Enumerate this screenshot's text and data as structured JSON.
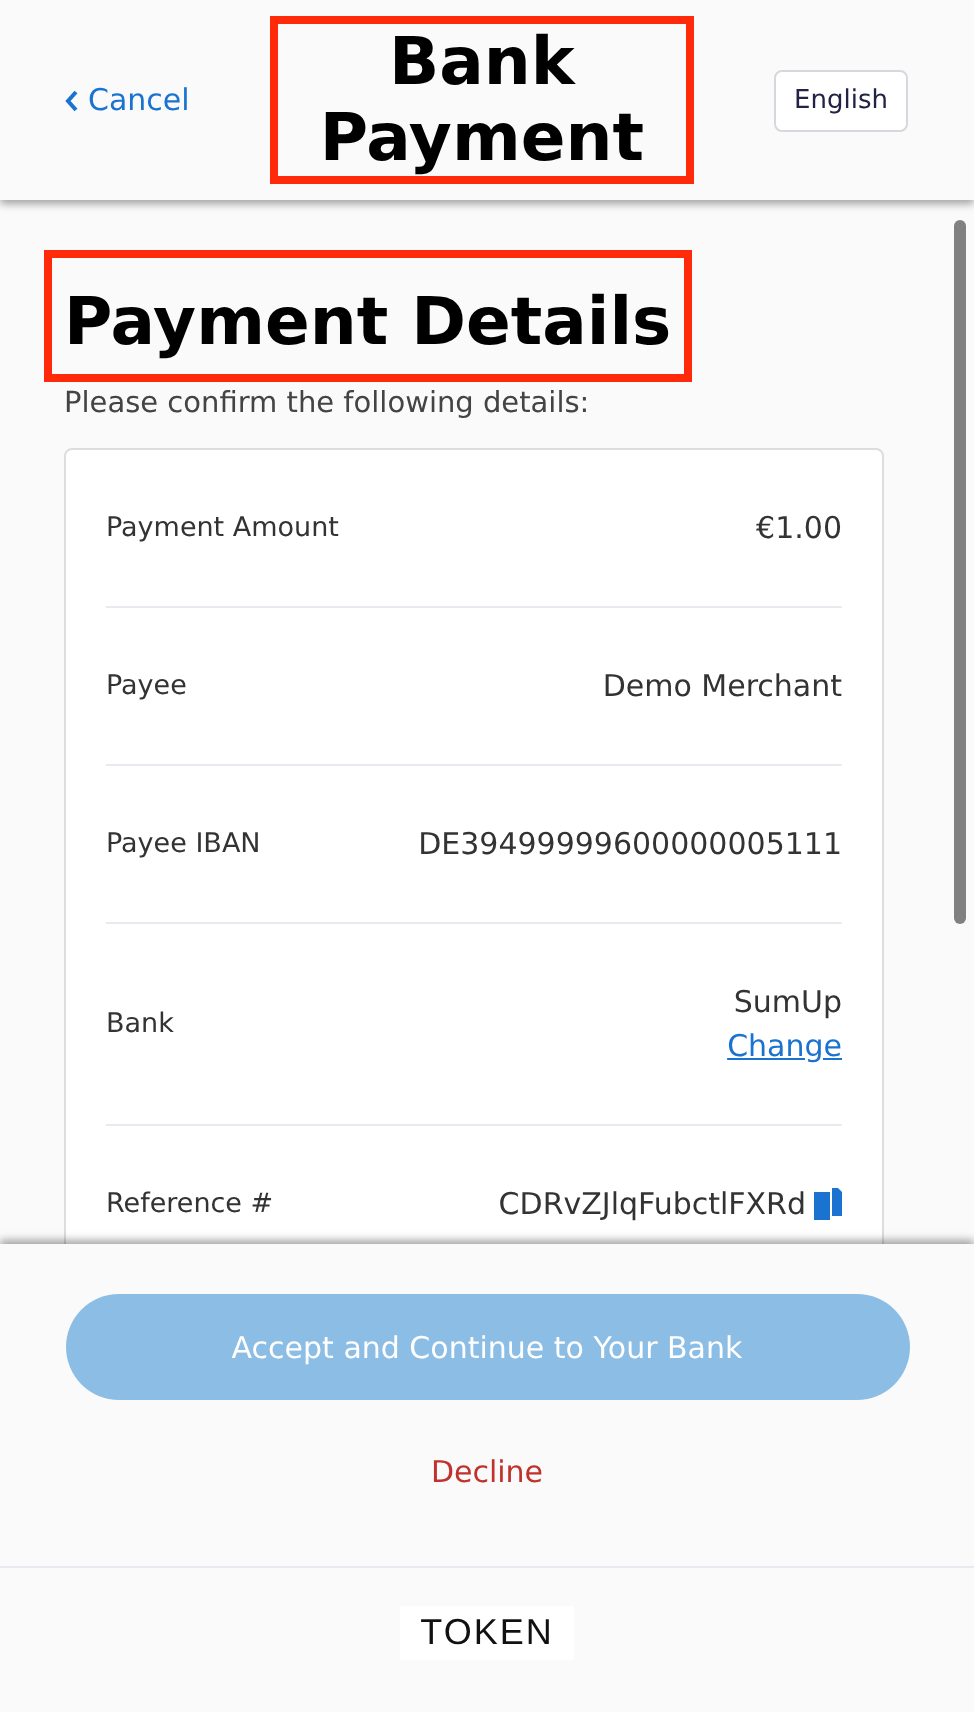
{
  "header": {
    "back_link": "Cancel",
    "title": "Bank Payment",
    "language_button": "English"
  },
  "content": {
    "heading": "Payment Details",
    "intro": "Please confirm the following details:",
    "rows": [
      {
        "kind": "text",
        "label": "Payment Amount",
        "value": "€1.00"
      },
      {
        "kind": "text",
        "label": "Payee",
        "value": "Demo Merchant"
      },
      {
        "kind": "text",
        "label": "Payee IBAN",
        "value": "DE39499999600000005111"
      },
      {
        "kind": "link",
        "label": "Bank",
        "value": "SumUp",
        "link": "Change"
      },
      {
        "kind": "copy",
        "label": "Reference #",
        "value": "CDRvZJlqFubctlFXRd"
      }
    ]
  },
  "footer": {
    "accept_button": {
      "label": "Accept and Continue to Your Bank",
      "disabled": true
    },
    "decline_link": "Decline",
    "brand": "TOKEN"
  }
}
